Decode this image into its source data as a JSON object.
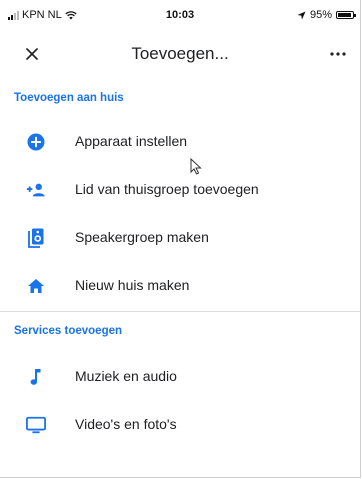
{
  "status_bar": {
    "carrier": "KPN NL",
    "time": "10:03",
    "battery": "95%"
  },
  "header": {
    "title": "Toevoegen...",
    "more_label": "•••"
  },
  "sections": [
    {
      "title": "Toevoegen aan huis",
      "items": [
        {
          "label": "Apparaat instellen",
          "icon": "add-circle-icon"
        },
        {
          "label": "Lid van thuisgroep toevoegen",
          "icon": "person-add-icon"
        },
        {
          "label": "Speakergroep maken",
          "icon": "speaker-group-icon"
        },
        {
          "label": "Nieuw huis maken",
          "icon": "home-icon"
        }
      ]
    },
    {
      "title": "Services toevoegen",
      "items": [
        {
          "label": "Muziek en audio",
          "icon": "music-note-icon"
        },
        {
          "label": "Video's en foto's",
          "icon": "monitor-icon"
        }
      ]
    }
  ],
  "colors": {
    "accent": "#1a73e8",
    "text": "#202124",
    "divider": "#dadce0"
  }
}
